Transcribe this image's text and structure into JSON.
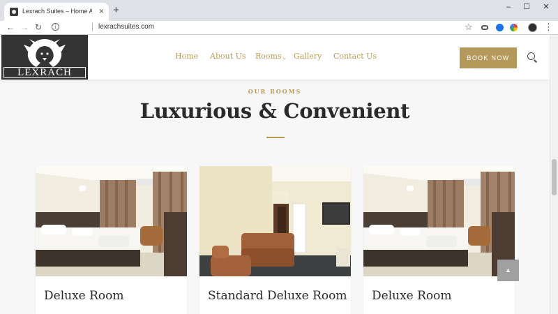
{
  "browser": {
    "tab_title": "Lexrach Suites – Home Away from Home",
    "tab_close": "×",
    "new_tab": "+",
    "url": "lexrachsuites.com",
    "back": "←",
    "forward": "→",
    "reload": "↻",
    "info": "i",
    "star": "☆",
    "menu": "⋮",
    "window_controls": {
      "minimize": "–",
      "maximize": "☐",
      "close": "✕"
    }
  },
  "site": {
    "logo_text": "LEXRACH",
    "nav": [
      {
        "label": "Home"
      },
      {
        "label": "About Us"
      },
      {
        "label": "Rooms"
      },
      {
        "label": "Gallery"
      },
      {
        "label": "Contact Us"
      }
    ],
    "rooms_caret": "⌄",
    "book_now": "BOOK NOW",
    "accent_color": "#b89a52"
  },
  "section": {
    "eyebrow": "OUR ROOMS",
    "headline": "Luxurious & Convenient"
  },
  "rooms": [
    {
      "title": "Deluxe Room"
    },
    {
      "title": "Standard Deluxe Room"
    },
    {
      "title": "Deluxe Room"
    }
  ],
  "back_to_top": "▲"
}
